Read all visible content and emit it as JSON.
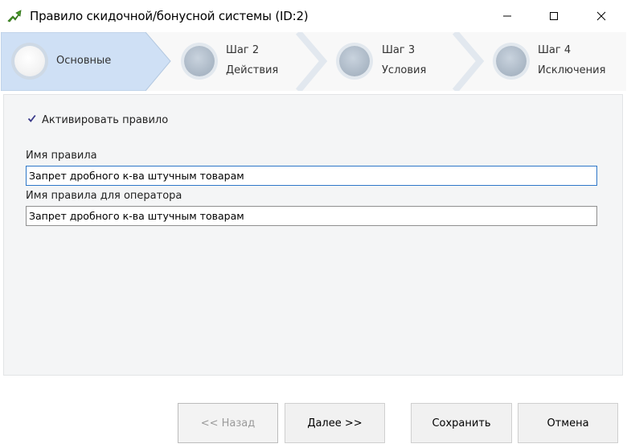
{
  "window": {
    "title": "Правило скидочной/бонусной системы (ID:2)",
    "icon": "arrow-icon",
    "controls": [
      "minimize-icon",
      "maximize-icon",
      "close-icon"
    ]
  },
  "steps": [
    {
      "title": "Основные",
      "subtitle": "",
      "active": true
    },
    {
      "title": "Шаг 2",
      "subtitle": "Действия",
      "active": false
    },
    {
      "title": "Шаг 3",
      "subtitle": "Условия",
      "active": false
    },
    {
      "title": "Шаг 4",
      "subtitle": "Исключения",
      "active": false
    }
  ],
  "form": {
    "activate_label": "Активировать правило",
    "activate_checked": true,
    "rule_name_label": "Имя правила",
    "rule_name_value": "Запрет дробного к-ва штучным товарам",
    "operator_name_label": "Имя правила для оператора",
    "operator_name_value": "Запрет дробного к-ва штучным товарам"
  },
  "buttons": {
    "back": "<< Назад",
    "next": "Далее >>",
    "save": "Сохранить",
    "cancel": "Отмена"
  },
  "colors": {
    "active_step": "#cfe0f5",
    "step_bar": "#f8f8f8",
    "panel": "#f4f5f6",
    "focus_border": "#2e77c8"
  }
}
